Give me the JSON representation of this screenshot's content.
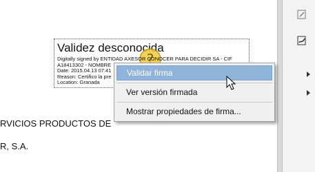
{
  "document": {
    "signature": {
      "status": "Validez desconocida",
      "details": [
        "Digitally signed by ENTIDAD AXESOR CONOCER PARA DECIDIR SA - CIF",
        "A18413302 - NOMBRE",
        "Date: 2015.04.13 07:41",
        "Reason: Certifico la pre",
        "Location: Granada"
      ]
    },
    "lines": [
      "RVICIOS PRODUCTOS DE",
      "R, S.A."
    ]
  },
  "context_menu": {
    "items": [
      {
        "label": "Validar firma",
        "highlighted": true
      },
      {
        "label": "Ver versión firmada",
        "highlighted": false
      },
      {
        "label": "Mostrar propiedades de firma...",
        "highlighted": false
      }
    ],
    "highlight_color": "#8fb3d9"
  },
  "panel": {
    "icons": [
      "edit-icon",
      "sign-icon"
    ],
    "arrows": [
      "expand-arrow-icon",
      "expand-arrow-icon"
    ]
  }
}
